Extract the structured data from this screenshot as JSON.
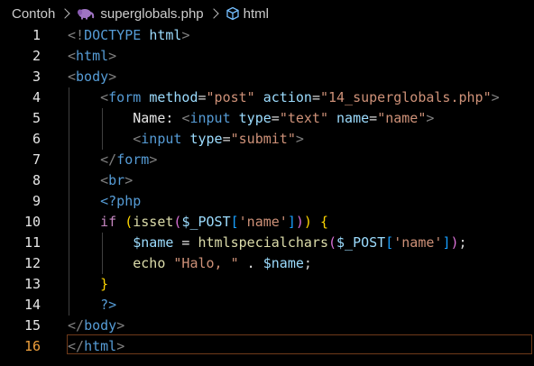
{
  "breadcrumb": {
    "folder": "Contoh",
    "file": "superglobals.php",
    "symbol": "html"
  },
  "colors": {
    "background": "#000000",
    "active_line_number": "#f0a03c",
    "tag": "#569cd6",
    "attribute": "#9cdcfe",
    "string": "#ce9178",
    "bracket": "#808080"
  },
  "editor": {
    "active_line": 16,
    "lines": [
      {
        "n": "1",
        "tokens": [
          [
            "br",
            "<!"
          ],
          [
            "tag",
            "DOCTYPE"
          ],
          [
            "txt",
            " "
          ],
          [
            "attr",
            "html"
          ],
          [
            "br",
            ">"
          ]
        ]
      },
      {
        "n": "2",
        "tokens": [
          [
            "br",
            "<"
          ],
          [
            "tag",
            "html"
          ],
          [
            "br",
            ">"
          ]
        ]
      },
      {
        "n": "3",
        "tokens": [
          [
            "br",
            "<"
          ],
          [
            "tag",
            "body"
          ],
          [
            "br",
            ">"
          ]
        ]
      },
      {
        "n": "4",
        "tokens": [
          [
            "txt",
            "    "
          ],
          [
            "br",
            "<"
          ],
          [
            "tag",
            "form"
          ],
          [
            "txt",
            " "
          ],
          [
            "attr",
            "method"
          ],
          [
            "punc",
            "="
          ],
          [
            "str",
            "\"post\""
          ],
          [
            "txt",
            " "
          ],
          [
            "attr",
            "action"
          ],
          [
            "punc",
            "="
          ],
          [
            "str",
            "\"14_superglobals.php\""
          ],
          [
            "br",
            ">"
          ]
        ]
      },
      {
        "n": "5",
        "tokens": [
          [
            "txt",
            "        Name: "
          ],
          [
            "br",
            "<"
          ],
          [
            "tag",
            "input"
          ],
          [
            "txt",
            " "
          ],
          [
            "attr",
            "type"
          ],
          [
            "punc",
            "="
          ],
          [
            "str",
            "\"text\""
          ],
          [
            "txt",
            " "
          ],
          [
            "attr",
            "name"
          ],
          [
            "punc",
            "="
          ],
          [
            "str",
            "\"name\""
          ],
          [
            "br",
            ">"
          ]
        ]
      },
      {
        "n": "6",
        "tokens": [
          [
            "txt",
            "        "
          ],
          [
            "br",
            "<"
          ],
          [
            "tag",
            "input"
          ],
          [
            "txt",
            " "
          ],
          [
            "attr",
            "type"
          ],
          [
            "punc",
            "="
          ],
          [
            "str",
            "\"submit\""
          ],
          [
            "br",
            ">"
          ]
        ]
      },
      {
        "n": "7",
        "tokens": [
          [
            "txt",
            "    "
          ],
          [
            "br",
            "</"
          ],
          [
            "tag",
            "form"
          ],
          [
            "br",
            ">"
          ]
        ]
      },
      {
        "n": "8",
        "tokens": [
          [
            "txt",
            "    "
          ],
          [
            "br",
            "<"
          ],
          [
            "tag",
            "br"
          ],
          [
            "br",
            ">"
          ]
        ]
      },
      {
        "n": "9",
        "tokens": [
          [
            "txt",
            "    "
          ],
          [
            "php",
            "<?php"
          ]
        ]
      },
      {
        "n": "10",
        "tokens": [
          [
            "txt",
            "    "
          ],
          [
            "kw",
            "if"
          ],
          [
            "txt",
            " "
          ],
          [
            "paren",
            "("
          ],
          [
            "fn",
            "isset"
          ],
          [
            "paren2",
            "("
          ],
          [
            "var",
            "$_POST"
          ],
          [
            "paren3",
            "["
          ],
          [
            "str",
            "'name'"
          ],
          [
            "paren3",
            "]"
          ],
          [
            "paren2",
            ")"
          ],
          [
            "paren",
            ")"
          ],
          [
            "txt",
            " "
          ],
          [
            "paren",
            "{"
          ]
        ]
      },
      {
        "n": "11",
        "tokens": [
          [
            "txt",
            "        "
          ],
          [
            "var",
            "$name"
          ],
          [
            "txt",
            " = "
          ],
          [
            "fn",
            "htmlspecialchars"
          ],
          [
            "paren2",
            "("
          ],
          [
            "var",
            "$_POST"
          ],
          [
            "paren3",
            "["
          ],
          [
            "str",
            "'name'"
          ],
          [
            "paren3",
            "]"
          ],
          [
            "paren2",
            ")"
          ],
          [
            "punc",
            ";"
          ]
        ]
      },
      {
        "n": "12",
        "tokens": [
          [
            "txt",
            "        "
          ],
          [
            "fn",
            "echo"
          ],
          [
            "txt",
            " "
          ],
          [
            "str",
            "\"Halo, \""
          ],
          [
            "txt",
            " . "
          ],
          [
            "var",
            "$name"
          ],
          [
            "punc",
            ";"
          ]
        ]
      },
      {
        "n": "13",
        "tokens": [
          [
            "txt",
            "    "
          ],
          [
            "paren",
            "}"
          ]
        ]
      },
      {
        "n": "14",
        "tokens": [
          [
            "txt",
            "    "
          ],
          [
            "php",
            "?>"
          ]
        ]
      },
      {
        "n": "15",
        "tokens": [
          [
            "br",
            "</"
          ],
          [
            "tag",
            "body"
          ],
          [
            "br",
            ">"
          ]
        ]
      },
      {
        "n": "16",
        "tokens": [
          [
            "br",
            "</"
          ],
          [
            "tag",
            "html"
          ],
          [
            "br",
            ">"
          ]
        ]
      }
    ]
  }
}
